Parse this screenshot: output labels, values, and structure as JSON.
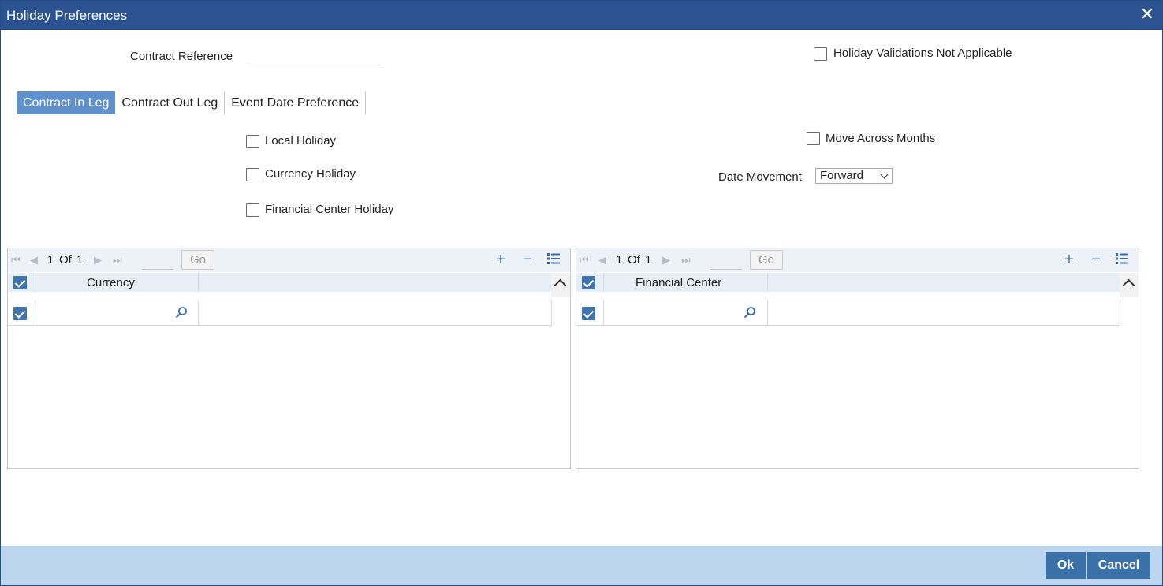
{
  "window": {
    "title": "Holiday Preferences"
  },
  "header": {
    "contract_reference_label": "Contract Reference",
    "contract_reference_value": "",
    "holiday_validations_label": "Holiday Validations Not Applicable"
  },
  "tabs": [
    {
      "label": "Contract In Leg"
    },
    {
      "label": "Contract Out Leg"
    },
    {
      "label": "Event Date Preference"
    }
  ],
  "options": {
    "local_holiday_label": "Local Holiday",
    "currency_holiday_label": "Currency Holiday",
    "financial_center_holiday_label": "Financial Center Holiday",
    "move_across_months_label": "Move Across Months",
    "date_movement_label": "Date Movement",
    "date_movement_value": "Forward"
  },
  "currency_grid": {
    "page_current": "1",
    "page_of": "Of",
    "page_total": "1",
    "go_label": "Go",
    "column_header": "Currency"
  },
  "financial_grid": {
    "page_current": "1",
    "page_of": "Of",
    "page_total": "1",
    "go_label": "Go",
    "column_header": "Financial Center"
  },
  "footer": {
    "ok_label": "Ok",
    "cancel_label": "Cancel"
  }
}
